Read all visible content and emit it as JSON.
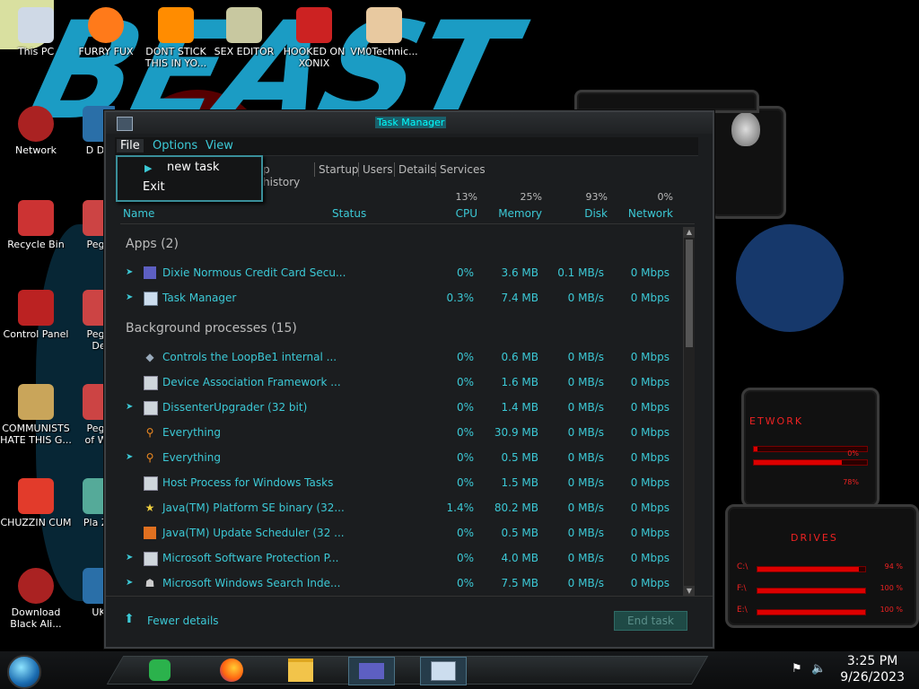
{
  "colors": {
    "accent": "#3cc9d6",
    "alien_red": "#e22222",
    "wallpaper_blue": "#1b9cc4"
  },
  "desktop": {
    "wallpaper_text": "BEAST",
    "icons": [
      {
        "label": "This PC",
        "icon": "computer-icon"
      },
      {
        "label": "FURRY FUX",
        "icon": "firefox-icon"
      },
      {
        "label": "DONT STICK THIS IN YO...",
        "icon": "vlc-cone-icon"
      },
      {
        "label": "SEX EDITOR",
        "icon": "hxd-editor-icon"
      },
      {
        "label": "HOOKED ON XONIX",
        "icon": "xonix-game-icon"
      },
      {
        "label": "VM0Technic...",
        "icon": "doctor-avatar-icon"
      },
      {
        "label": "Network",
        "icon": "network-icon"
      },
      {
        "label": "Recycle Bin",
        "icon": "recycle-bin-icon"
      },
      {
        "label": "Control Panel",
        "icon": "control-panel-icon"
      },
      {
        "label": "COMMUNISTS HATE THIS G...",
        "icon": "money-bag-icon"
      },
      {
        "label": "CHUZZIN CUM",
        "icon": "chuzzle-icon"
      },
      {
        "label": "Download Black Ali...",
        "icon": "alien-orb-icon"
      },
      {
        "label": "D DU",
        "icon": "partial-icon"
      },
      {
        "label": "Pegg",
        "icon": "peggle-icon"
      },
      {
        "label": "Pegg De",
        "icon": "peggle-icon"
      },
      {
        "label": "Pegg of Wa",
        "icon": "peggle-icon"
      },
      {
        "label": "Pla Zo",
        "icon": "plants-icon"
      },
      {
        "label": "UK",
        "icon": "partial-icon"
      }
    ]
  },
  "gadgets": {
    "network": {
      "title": "ETWORK",
      "stat1": "0%",
      "stat2": "78%",
      "bar1": 0.03,
      "bar2": 0.78
    },
    "drives": {
      "title": "DRIVES",
      "items": [
        {
          "label": "C:\\",
          "pct": "94 %",
          "fill": 0.94
        },
        {
          "label": "F:\\",
          "pct": "100 %",
          "fill": 1.0
        },
        {
          "label": "E:\\",
          "pct": "100 %",
          "fill": 1.0
        }
      ]
    }
  },
  "taskmgr": {
    "title": "Task Manager",
    "menu": {
      "file": "File",
      "options": "Options",
      "view": "View"
    },
    "dropdown": {
      "run_new_task": "new task",
      "exit": "Exit"
    },
    "tabs": [
      "p history",
      "Startup",
      "Users",
      "Details",
      "Services"
    ],
    "columns": {
      "name": "Name",
      "status": "Status",
      "cpu": {
        "label": "CPU",
        "pct": "13%"
      },
      "memory": {
        "label": "Memory",
        "pct": "25%"
      },
      "disk": {
        "label": "Disk",
        "pct": "93%"
      },
      "network": {
        "label": "Network",
        "pct": "0%"
      }
    },
    "groups": {
      "apps": "Apps (2)",
      "background": "Background processes (15)"
    },
    "apps": [
      {
        "name": "Dixie Normous Credit Card Secu...",
        "cpu": "0%",
        "memory": "3.6 MB",
        "disk": "0.1 MB/s",
        "network": "0 Mbps",
        "icon": "card-icon",
        "expand": true
      },
      {
        "name": "Task Manager",
        "cpu": "0.3%",
        "memory": "7.4 MB",
        "disk": "0 MB/s",
        "network": "0 Mbps",
        "icon": "task-manager-icon",
        "expand": true
      }
    ],
    "background": [
      {
        "name": "Controls the LoopBe1 internal ...",
        "cpu": "0%",
        "memory": "0.6 MB",
        "disk": "0 MB/s",
        "network": "0 Mbps",
        "icon": "loopbe-icon",
        "expand": false
      },
      {
        "name": "Device Association Framework ...",
        "cpu": "0%",
        "memory": "1.6 MB",
        "disk": "0 MB/s",
        "network": "0 Mbps",
        "icon": "window-icon",
        "expand": false
      },
      {
        "name": "DissenterUpgrader (32 bit)",
        "cpu": "0%",
        "memory": "1.4 MB",
        "disk": "0 MB/s",
        "network": "0 Mbps",
        "icon": "window-icon",
        "expand": true
      },
      {
        "name": "Everything",
        "cpu": "0%",
        "memory": "30.9 MB",
        "disk": "0 MB/s",
        "network": "0 Mbps",
        "icon": "magnifier-icon",
        "expand": false
      },
      {
        "name": "Everything",
        "cpu": "0%",
        "memory": "0.5 MB",
        "disk": "0 MB/s",
        "network": "0 Mbps",
        "icon": "magnifier-icon",
        "expand": true
      },
      {
        "name": "Host Process for Windows Tasks",
        "cpu": "0%",
        "memory": "1.5 MB",
        "disk": "0 MB/s",
        "network": "0 Mbps",
        "icon": "window-icon",
        "expand": false
      },
      {
        "name": "Java(TM) Platform SE binary (32...",
        "cpu": "1.4%",
        "memory": "80.2 MB",
        "disk": "0 MB/s",
        "network": "0 Mbps",
        "icon": "star-icon",
        "expand": false
      },
      {
        "name": "Java(TM) Update Scheduler (32 ...",
        "cpu": "0%",
        "memory": "0.5 MB",
        "disk": "0 MB/s",
        "network": "0 Mbps",
        "icon": "java-icon",
        "expand": false
      },
      {
        "name": "Microsoft Software Protection P...",
        "cpu": "0%",
        "memory": "4.0 MB",
        "disk": "0 MB/s",
        "network": "0 Mbps",
        "icon": "window-icon",
        "expand": true
      },
      {
        "name": "Microsoft Windows Search Inde...",
        "cpu": "0%",
        "memory": "7.5 MB",
        "disk": "0 MB/s",
        "network": "0 Mbps",
        "icon": "search-indexer-icon",
        "expand": true
      }
    ],
    "fewer_details": "Fewer details",
    "end_task": "End task"
  },
  "taskbar": {
    "time": "3:25 PM",
    "date": "9/26/2023",
    "pinned": [
      "feedly-icon",
      "firefox-icon",
      "file-explorer-icon",
      "card-app-icon",
      "task-manager-icon"
    ]
  }
}
